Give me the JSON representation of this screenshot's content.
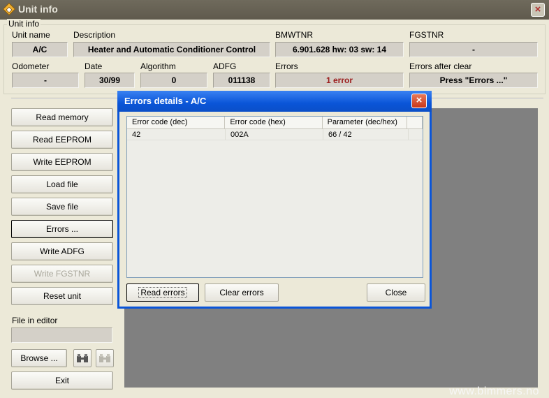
{
  "window": {
    "title": "Unit info",
    "close_label": "×"
  },
  "group_label": "Unit info",
  "fields": {
    "unit_name": {
      "label": "Unit name",
      "value": "A/C"
    },
    "description": {
      "label": "Description",
      "value": "Heater and Automatic Conditioner Control"
    },
    "bmwtnr": {
      "label": "BMWTNR",
      "value": "6.901.628   hw: 03   sw: 14"
    },
    "fgstnr": {
      "label": "FGSTNR",
      "value": "-"
    },
    "odometer": {
      "label": "Odometer",
      "value": "-"
    },
    "date": {
      "label": "Date",
      "value": "30/99"
    },
    "algorithm": {
      "label": "Algorithm",
      "value": "0"
    },
    "adfg": {
      "label": "ADFG",
      "value": "011138"
    },
    "errors": {
      "label": "Errors",
      "value": "1 error"
    },
    "errors_after_clear": {
      "label": "Errors after clear",
      "value": "Press \"Errors ...\""
    }
  },
  "buttons": {
    "read_memory": "Read memory",
    "read_eeprom": "Read EEPROM",
    "write_eeprom": "Write EEPROM",
    "load_file": "Load file",
    "save_file": "Save file",
    "errors": "Errors ...",
    "write_adfg": "Write ADFG",
    "write_fgstnr": "Write FGSTNR",
    "reset_unit": "Reset unit",
    "browse": "Browse ...",
    "exit": "Exit"
  },
  "file_in_editor": {
    "label": "File in editor",
    "value": ""
  },
  "icons": {
    "binoculars": "binoculars-icon",
    "binoculars_dim": "binoculars-disabled-icon"
  },
  "dialog": {
    "title": "Errors details - A/C",
    "close_label": "×",
    "columns": [
      "Error code (dec)",
      "Error code (hex)",
      "Parameter (dec/hex)"
    ],
    "rows": [
      [
        "42",
        "002A",
        "66 / 42"
      ]
    ],
    "read_errors": "Read errors",
    "clear_errors": "Clear errors",
    "close": "Close"
  },
  "watermark": "www.bimmers.no",
  "colors": {
    "title_bar": "#0a55d8",
    "error_text": "#9b1b1b",
    "workspace": "#808080"
  }
}
